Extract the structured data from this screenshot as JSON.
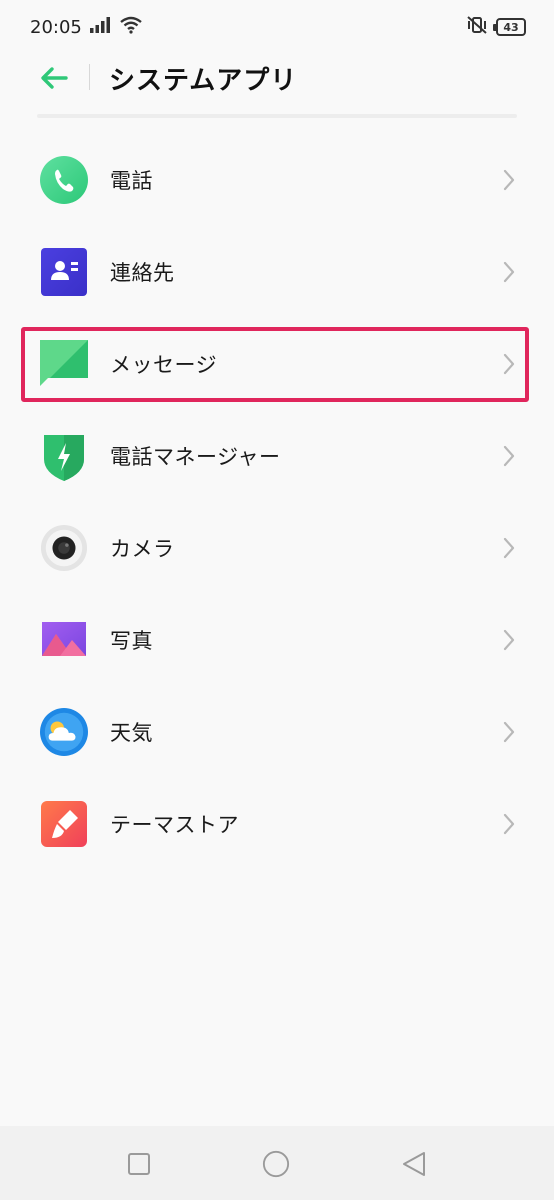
{
  "status_bar": {
    "time": "20:05",
    "battery": "43",
    "icons": [
      "signal-icon",
      "wifi-icon",
      "vibrate-off-icon",
      "battery-icon"
    ]
  },
  "header": {
    "title": "システムアプリ",
    "back_icon": "back-arrow-icon"
  },
  "colors": {
    "accent": "#2fc878",
    "highlight": "#e0265c"
  },
  "apps": [
    {
      "label": "電話",
      "icon": "phone-icon"
    },
    {
      "label": "連絡先",
      "icon": "contacts-icon"
    },
    {
      "label": "メッセージ",
      "icon": "messages-icon",
      "highlighted": true
    },
    {
      "label": "電話マネージャー",
      "icon": "phone-manager-shield-icon"
    },
    {
      "label": "カメラ",
      "icon": "camera-icon"
    },
    {
      "label": "写真",
      "icon": "photos-icon"
    },
    {
      "label": "天気",
      "icon": "weather-icon"
    },
    {
      "label": "テーマストア",
      "icon": "theme-store-icon"
    }
  ],
  "nav_bar": {
    "buttons": [
      "recents-square-icon",
      "home-circle-icon",
      "back-triangle-icon"
    ]
  }
}
